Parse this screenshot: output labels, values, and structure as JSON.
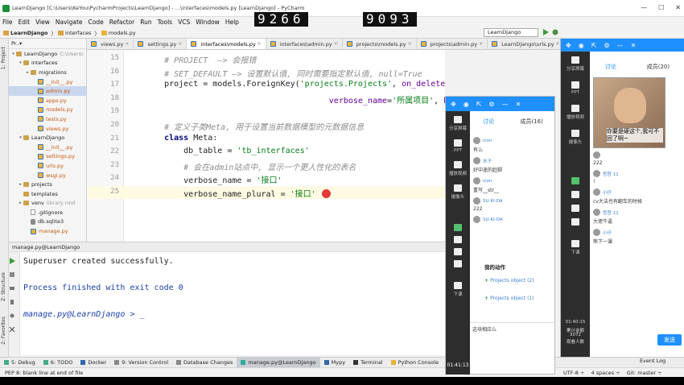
{
  "window": {
    "title": "LearnDjango [C:\\Users\\KeYou\\PycharmProjects\\LearnDjango] - ...\\interfaces\\models.py [LearnDjango] - PyCharm",
    "controls": [
      "—",
      "☐",
      "✕"
    ]
  },
  "overlay_counters": [
    "9266",
    "9093"
  ],
  "menu": [
    "File",
    "Edit",
    "View",
    "Navigate",
    "Code",
    "Refactor",
    "Run",
    "Tools",
    "VCS",
    "Window",
    "Help"
  ],
  "navbar": {
    "crumbs": [
      "LearnDjango",
      "interfaces",
      "models.py"
    ],
    "run_config": "LearnDjango"
  },
  "project_panel": {
    "header": "Pr..▾",
    "items": [
      {
        "label": "LearnDjango",
        "suffix": "C:\\Users\\",
        "type": "folder",
        "arrow": "▾",
        "indent": 0
      },
      {
        "label": "interfaces",
        "type": "folder",
        "arrow": "▾",
        "indent": 1
      },
      {
        "label": "migrations",
        "type": "folder",
        "arrow": "▸",
        "indent": 2
      },
      {
        "label": "__init__.py",
        "type": "py",
        "indent": 3
      },
      {
        "label": "admin.py",
        "type": "py",
        "indent": 3,
        "selected": true
      },
      {
        "label": "apps.py",
        "type": "py",
        "indent": 3
      },
      {
        "label": "models.py",
        "type": "py",
        "indent": 3
      },
      {
        "label": "tests.py",
        "type": "py",
        "indent": 3
      },
      {
        "label": "views.py",
        "type": "py",
        "indent": 3
      },
      {
        "label": "LearnDjango",
        "type": "folder",
        "arrow": "▾",
        "indent": 1
      },
      {
        "label": "__init__.py",
        "type": "py",
        "indent": 3
      },
      {
        "label": "settings.py",
        "type": "py",
        "indent": 3
      },
      {
        "label": "urls.py",
        "type": "py",
        "indent": 3
      },
      {
        "label": "wsgi.py",
        "type": "py",
        "indent": 3
      },
      {
        "label": "projects",
        "type": "folder",
        "arrow": "▸",
        "indent": 1
      },
      {
        "label": "templates",
        "type": "folder",
        "arrow": "",
        "indent": 1
      },
      {
        "label": "venv",
        "suffix": "library root",
        "type": "folder",
        "arrow": "▸",
        "indent": 1
      },
      {
        "label": ".gitignore",
        "type": "file",
        "indent": 2
      },
      {
        "label": "db.sqlite3",
        "type": "db",
        "indent": 2
      },
      {
        "label": "manage.py",
        "type": "py",
        "indent": 2
      }
    ]
  },
  "editor_tabs": [
    {
      "label": "views.py",
      "active": false
    },
    {
      "label": "settings.py",
      "active": false
    },
    {
      "label": "interfaces\\models.py",
      "active": true
    },
    {
      "label": "interfaces\\admin.py",
      "active": false
    },
    {
      "label": "projects\\models.py",
      "active": false
    },
    {
      "label": "projects\\admin.py",
      "active": false
    },
    {
      "label": "LearnDjango\\urls.py",
      "active": false
    },
    {
      "label": "p...",
      "active": false
    }
  ],
  "code": {
    "lines": [
      {
        "n": "15",
        "parts": [
          {
            "t": "    # PROJECT  —> 会报错",
            "c": "cm"
          }
        ]
      },
      {
        "n": "16",
        "parts": [
          {
            "t": "    # SET_DEFAULT —> 设置默认值, 同时需要指定默认值, null=True",
            "c": "cm"
          }
        ]
      },
      {
        "n": "17",
        "parts": [
          {
            "t": "    project = models.ForeignKey(",
            "c": ""
          },
          {
            "t": "'projects.Projects'",
            "c": "str"
          },
          {
            "t": ", ",
            "c": ""
          },
          {
            "t": "on_delete",
            "c": "kwarg"
          },
          {
            "t": "=models.CASCADE,",
            "c": ""
          }
        ]
      },
      {
        "n": "18",
        "parts": [
          {
            "t": "                                      ",
            "c": ""
          },
          {
            "t": "verbose_name",
            "c": "kwarg"
          },
          {
            "t": "=",
            "c": ""
          },
          {
            "t": "'所属项目'",
            "c": "str"
          },
          {
            "t": ", ",
            "c": ""
          },
          {
            "t": "help_text",
            "c": "kwarg"
          },
          {
            "t": "=",
            "c": ""
          },
          {
            "t": "'所属项目'",
            "c": "str"
          },
          {
            "t": ")",
            "c": ""
          }
        ]
      },
      {
        "n": "19",
        "parts": []
      },
      {
        "n": "20",
        "parts": [
          {
            "t": "    # 定义子类Meta, 用于设置当前数据模型的元数据信息",
            "c": "cm"
          }
        ]
      },
      {
        "n": "21",
        "parts": [
          {
            "t": "    ",
            "c": ""
          },
          {
            "t": "class",
            "c": "kw"
          },
          {
            "t": " Meta:",
            "c": ""
          }
        ]
      },
      {
        "n": "22",
        "parts": [
          {
            "t": "        db_table = ",
            "c": ""
          },
          {
            "t": "'tb_interfaces'",
            "c": "str"
          }
        ]
      },
      {
        "n": "23",
        "parts": [
          {
            "t": "        # 会在admin站点中, 显示一个更人性化的表名",
            "c": "cm"
          }
        ]
      },
      {
        "n": "24",
        "parts": [
          {
            "t": "        verbose_name = ",
            "c": ""
          },
          {
            "t": "'接口'",
            "c": "str"
          }
        ]
      },
      {
        "n": "25",
        "parts": [
          {
            "t": "        verbose_name_plural = ",
            "c": ""
          },
          {
            "t": "'接口'",
            "c": "str"
          }
        ],
        "current": true
      }
    ]
  },
  "run_panel": {
    "header": "manage.py@LearnDjango",
    "output": [
      {
        "text": "Superuser created successfully.",
        "color": "#222",
        "italic": false
      },
      {
        "text": "",
        "color": "#222",
        "italic": false
      },
      {
        "text": "Process finished with exit code 0",
        "color": "#1a3ea8",
        "italic": false
      },
      {
        "text": "",
        "color": "#222",
        "italic": false
      },
      {
        "text": "manage.py@LearnDjango > _",
        "color": "#1a3ea8",
        "italic": true
      }
    ]
  },
  "left_strip_tabs": [
    "1: Project",
    "Z: Structure",
    "2: Favorites"
  ],
  "bottom_tools": [
    {
      "label": "5: Debug",
      "active": false
    },
    {
      "label": "6: TODO",
      "active": false
    },
    {
      "label": "Docker",
      "active": false
    },
    {
      "label": "9: Version Control",
      "active": false
    },
    {
      "label": "Database Changes",
      "active": false
    },
    {
      "label": "manage.py@LearnDjango",
      "active": true
    },
    {
      "label": "Mypy",
      "active": false
    },
    {
      "label": "Terminal",
      "active": false
    },
    {
      "label": "Python Console",
      "active": false
    }
  ],
  "event_log": "Event Log",
  "status": {
    "message": "PEP 8: blank line at end of file",
    "encoding": "UTF-8 ÷",
    "indent": "4 spaces ÷",
    "git": "Git: master ÷"
  },
  "chat_mid": {
    "tabs": [
      "讨论",
      "成员(16)"
    ],
    "side_labels": [
      "分享屏幕",
      "PPT",
      "播放视频",
      "摄像头",
      "下课"
    ],
    "messages": [
      {
        "who": "icon",
        "body": "有么"
      },
      {
        "who": "木子",
        "body": "好中遥的赶脚"
      },
      {
        "who": "icon",
        "body": "重写__str__"
      },
      {
        "who": "SU-KI-DA",
        "body": "222"
      },
      {
        "who": "SU-KI-DA",
        "body": ""
      }
    ],
    "actions_title": "我的动作",
    "actions": [
      "Projects object (2)",
      "Projects object (1)"
    ],
    "input_text": "这块相应么",
    "clock": "01:41:13"
  },
  "chat_right": {
    "tabs": [
      "讨论",
      "成员(20)"
    ],
    "side_labels": [
      "分享屏幕",
      "PPT",
      "播放视频",
      "摄像头",
      "下课"
    ],
    "meme_caption": "你要是硬这个,我可不回了啊~",
    "messages": [
      {
        "who": "",
        "body": "222"
      },
      {
        "who": "哲哲 11",
        "body": "!"
      },
      {
        "who": "小仔",
        "body": "cv大法也有翻车的时候"
      },
      {
        "who": "哲哲 11",
        "body": "大佬牛逼"
      },
      {
        "who": "小仔",
        "body": "熊下一课"
      }
    ],
    "send": "发送",
    "stats": [
      "01:40:15",
      "累计金额",
      "3072",
      "观看人数"
    ]
  }
}
